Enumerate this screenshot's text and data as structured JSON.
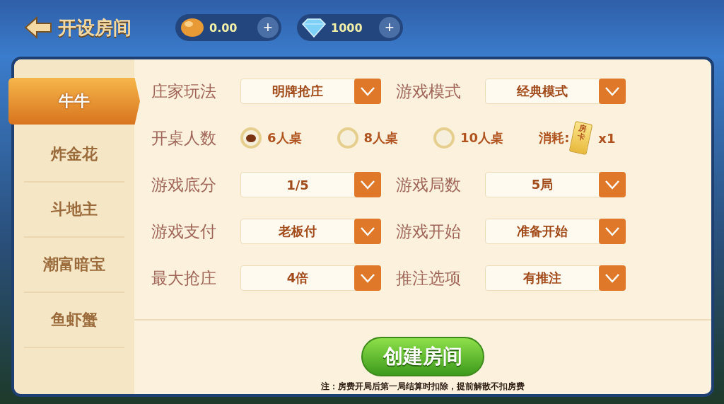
{
  "header": {
    "title": "开设房间",
    "currencies": [
      {
        "kind": "bean",
        "amount": "0.00",
        "add": "+"
      },
      {
        "kind": "diamond",
        "amount": "1000",
        "add": "+"
      }
    ]
  },
  "sidebar": {
    "items": [
      {
        "label": "牛牛",
        "selected": true
      },
      {
        "label": "炸金花",
        "selected": false
      },
      {
        "label": "斗地主",
        "selected": false
      },
      {
        "label": "潮富暗宝",
        "selected": false
      },
      {
        "label": "鱼虾蟹",
        "selected": false
      }
    ]
  },
  "settings": [
    {
      "kind": "selects",
      "fields": [
        {
          "label": "庄家玩法",
          "value": "明牌抢庄"
        },
        {
          "label": "游戏模式",
          "value": "经典模式"
        }
      ]
    },
    {
      "kind": "radios",
      "label": "开桌人数",
      "options": [
        {
          "label": "6人桌",
          "selected": true
        },
        {
          "label": "8人桌",
          "selected": false
        },
        {
          "label": "10人桌",
          "selected": false
        }
      ],
      "cost_label": "消耗:",
      "card_text": "房卡",
      "cost": "x1"
    },
    {
      "kind": "selects",
      "fields": [
        {
          "label": "游戏底分",
          "value": "1/5"
        },
        {
          "label": "游戏局数",
          "value": "5局"
        }
      ]
    },
    {
      "kind": "selects",
      "fields": [
        {
          "label": "游戏支付",
          "value": "老板付"
        },
        {
          "label": "游戏开始",
          "value": "准备开始"
        }
      ]
    },
    {
      "kind": "selects",
      "fields": [
        {
          "label": "最大抢庄",
          "value": "4倍"
        },
        {
          "label": "推注选项",
          "value": "有推注"
        }
      ]
    }
  ],
  "create_button": "创建房间",
  "note": "注：房费开局后第一局结算时扣除，提前解散不扣房费"
}
